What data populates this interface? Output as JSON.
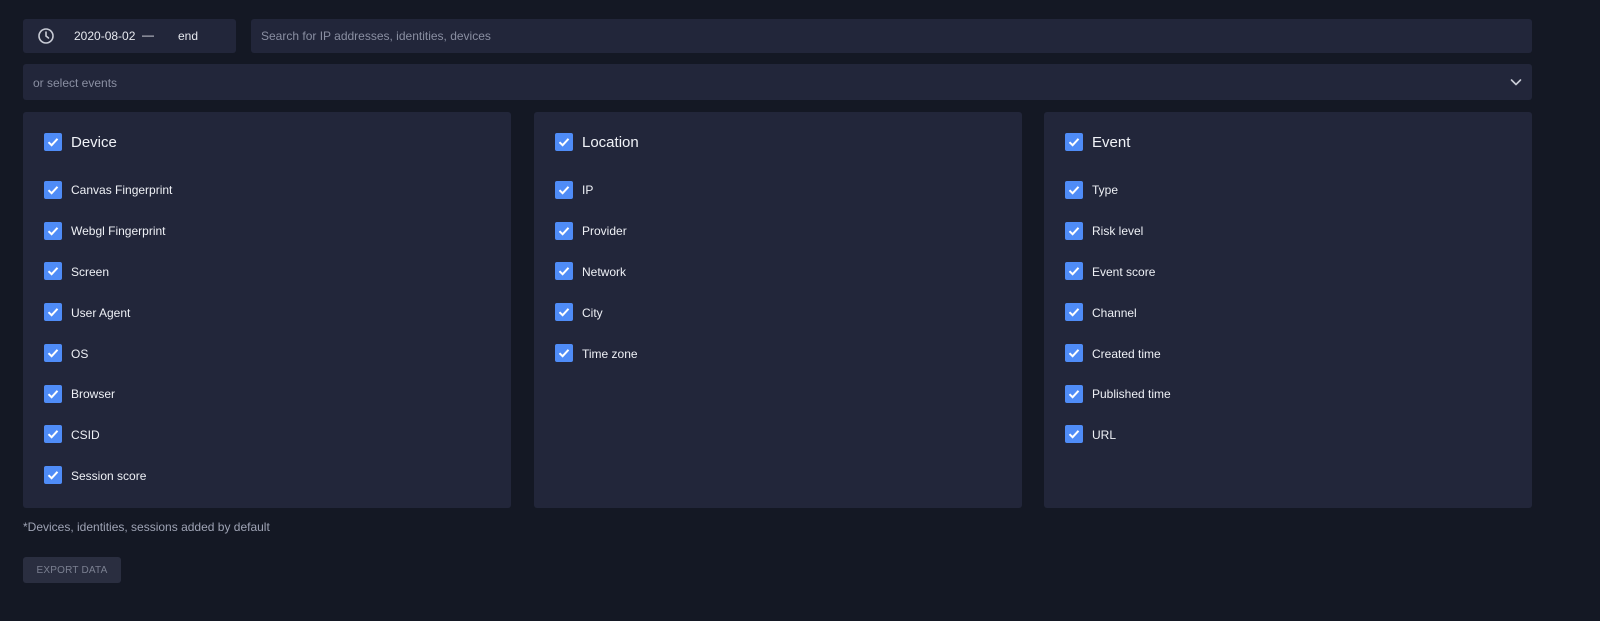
{
  "date_range": {
    "start": "2020-08-02",
    "separator": "—",
    "end": "end",
    "icon": "clock-icon"
  },
  "search": {
    "placeholder": "Search for IP addresses, identities, devices",
    "value": ""
  },
  "event_select": {
    "placeholder": "or select events",
    "icon": "chevron-down-icon"
  },
  "panels": [
    {
      "title": "Device",
      "checked": true,
      "items": [
        {
          "label": "Canvas Fingerprint",
          "checked": true
        },
        {
          "label": "Webgl Fingerprint",
          "checked": true
        },
        {
          "label": "Screen",
          "checked": true
        },
        {
          "label": "User Agent",
          "checked": true
        },
        {
          "label": "OS",
          "checked": true
        },
        {
          "label": "Browser",
          "checked": true
        },
        {
          "label": "CSID",
          "checked": true
        },
        {
          "label": "Session score",
          "checked": true
        }
      ]
    },
    {
      "title": "Location",
      "checked": true,
      "items": [
        {
          "label": "IP",
          "checked": true
        },
        {
          "label": "Provider",
          "checked": true
        },
        {
          "label": "Network",
          "checked": true
        },
        {
          "label": "City",
          "checked": true
        },
        {
          "label": "Time zone",
          "checked": true
        }
      ]
    },
    {
      "title": "Event",
      "checked": true,
      "items": [
        {
          "label": "Type",
          "checked": true
        },
        {
          "label": "Risk level",
          "checked": true
        },
        {
          "label": "Event score",
          "checked": true
        },
        {
          "label": "Channel",
          "checked": true
        },
        {
          "label": "Created time",
          "checked": true
        },
        {
          "label": "Published time",
          "checked": true
        },
        {
          "label": "URL",
          "checked": true
        }
      ]
    }
  ],
  "footnote": "*Devices, identities, sessions added by default",
  "export_button": "EXPORT DATA",
  "colors": {
    "background": "#141824",
    "panel": "#22263a",
    "checkbox": "#4f8cf7"
  }
}
